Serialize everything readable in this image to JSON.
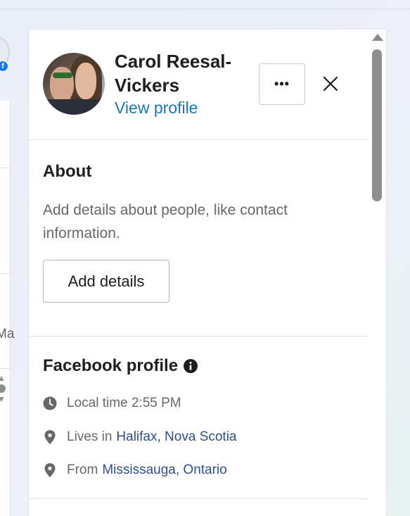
{
  "contact": {
    "name": "Carol Reesal-Vickers",
    "view_profile_label": "View profile",
    "more_label": "•••"
  },
  "about": {
    "title": "About",
    "description": "Add details about people, like contact information.",
    "add_details_label": "Add details"
  },
  "facebook_profile": {
    "title": "Facebook profile",
    "local_time_label": "Local time 2:55 PM",
    "lives_prefix": "Lives in",
    "lives_link": "Halifax, Nova Scotia",
    "from_prefix": "From",
    "from_link": "Mississauga, Ontario"
  },
  "background": {
    "partial_text": "Ma"
  },
  "colors": {
    "link_blue": "#1a77b3",
    "place_link": "#2d4e8a",
    "facebook_blue": "#1877f2",
    "text_primary": "#1c1e21",
    "text_secondary": "#65676b"
  },
  "icons": [
    "facebook-badge-icon",
    "more-icon",
    "close-icon",
    "info-icon",
    "clock-icon",
    "location-pin-icon",
    "scroll-up-arrow-icon"
  ]
}
